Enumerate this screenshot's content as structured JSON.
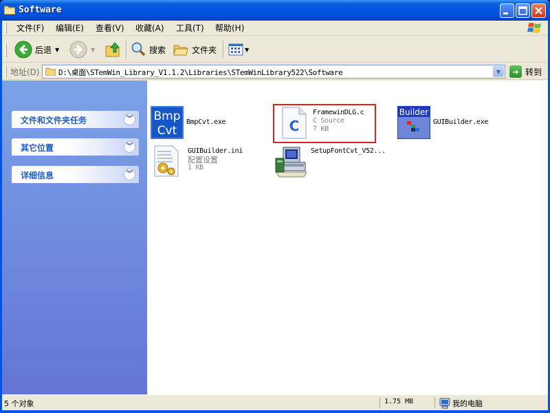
{
  "window": {
    "title": "Software",
    "controls": {
      "minimize": "minimize",
      "maximize": "maximize",
      "close": "close"
    }
  },
  "menu": [
    "文件(F)",
    "编辑(E)",
    "查看(V)",
    "收藏(A)",
    "工具(T)",
    "帮助(H)"
  ],
  "toolbar": {
    "back": "后退",
    "search": "搜索",
    "folders": "文件夹"
  },
  "address": {
    "label": "地址(D)",
    "path": "D:\\桌面\\STemWin_Library_V1.1.2\\Libraries\\STemWinLibrary522\\Software",
    "go": "转到"
  },
  "taskpane": {
    "panels": [
      "文件和文件夹任务",
      "其它位置",
      "详细信息"
    ]
  },
  "files": [
    {
      "name": "BmpCvt.exe",
      "icon": "bmpcvt-app-icon",
      "icon_text": [
        "Bmp",
        "Cvt"
      ]
    },
    {
      "name": "FramewinDLG.c",
      "type": "C Source",
      "size": "7 KB",
      "icon": "c-source-file-icon"
    },
    {
      "name": "GUIBuilder.exe",
      "icon": "guibuilder-app-icon",
      "icon_text": "Builder"
    },
    {
      "name": "GUIBuilder.ini",
      "type": "配置设置",
      "size": "1 KB",
      "icon": "ini-config-file-icon"
    },
    {
      "name": "SetupFontCvt_V52...",
      "icon": "setup-installer-icon"
    }
  ],
  "status": {
    "count": "5 个对象",
    "size": "1.75 MB",
    "location": "我的电脑"
  },
  "colors": {
    "titlebar": "#0054e3",
    "taskpane_top": "#7ba2e7",
    "taskpane_bottom": "#6375d6",
    "panel_title": "#215dc6",
    "highlight_border": "#e02020"
  }
}
